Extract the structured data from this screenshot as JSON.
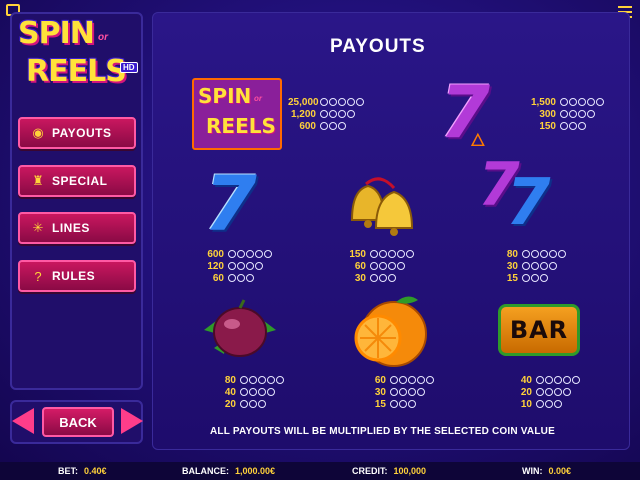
{
  "page_title": "PAYOUTS",
  "logo": {
    "word1": "SPIN",
    "or": "or",
    "word2": "REELS",
    "badge": "HD"
  },
  "nav": [
    {
      "label": "PAYOUTS",
      "icon": "coins-icon"
    },
    {
      "label": "SPECIAL",
      "icon": "joystick-icon"
    },
    {
      "label": "LINES",
      "icon": "lines-icon"
    },
    {
      "label": "RULES",
      "icon": "question-icon"
    }
  ],
  "back_label": "BACK",
  "payouts": {
    "spin_reels": {
      "values": [
        "25,000",
        "1,200",
        "600"
      ],
      "counts": [
        5,
        4,
        3
      ]
    },
    "purple_seven": {
      "values": [
        "1,500",
        "300",
        "150"
      ],
      "counts": [
        5,
        4,
        3
      ]
    },
    "blue_seven": {
      "values": [
        "600",
        "120",
        "60"
      ],
      "counts": [
        5,
        4,
        3
      ]
    },
    "bells": {
      "values": [
        "150",
        "60",
        "30"
      ],
      "counts": [
        5,
        4,
        3
      ]
    },
    "any_seven": {
      "values": [
        "80",
        "30",
        "15"
      ],
      "counts": [
        5,
        4,
        3
      ]
    },
    "plum": {
      "values": [
        "80",
        "40",
        "20"
      ],
      "counts": [
        5,
        4,
        3
      ]
    },
    "orange": {
      "values": [
        "60",
        "30",
        "15"
      ],
      "counts": [
        5,
        4,
        3
      ]
    },
    "bar": {
      "values": [
        "40",
        "20",
        "10"
      ],
      "counts": [
        5,
        4,
        3
      ]
    }
  },
  "symbols": {
    "bar_text": "BAR",
    "seven": "7"
  },
  "footer_note": "ALL PAYOUTS WILL BE MULTIPLIED BY THE SELECTED COIN VALUE",
  "status": {
    "bet_label": "BET:",
    "bet_value": "0.40€",
    "balance_label": "BALANCE:",
    "balance_value": "1,000.00€",
    "credit_label": "CREDIT:",
    "credit_value": "100,000",
    "win_label": "WIN:",
    "win_value": "0.00€"
  },
  "colors": {
    "accent": "#ffd23a",
    "button": "#c9175f",
    "background": "#21107a"
  }
}
